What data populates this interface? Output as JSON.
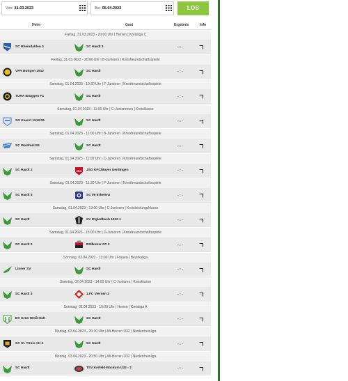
{
  "filter": {
    "from_label": "Von:",
    "from_value": "31.03.2023",
    "to_label": "Bis:",
    "to_value": "05.04.2023",
    "submit_label": "LOS"
  },
  "columns": {
    "home": "Heim",
    "away": "Gast",
    "result": "Ergebnis",
    "info": "Info"
  },
  "colors": {
    "accent": "#8dc63f",
    "sidebar": "#2f6e2f"
  },
  "matches": [
    {
      "header": "Freitag, 31.03.2023 - 20:00 Uhr | Herren | Kreisliga C",
      "home": "SC Rheindahlen 3",
      "home_crest": "crest-blue-shield",
      "away": "SC Hardt 3",
      "away_crest": "crest-green-hardt",
      "score": "- : -"
    },
    {
      "header": "Freitag, 31.03.2023 - 20:00 Uhr | B-Junioren | Kreisfreundschaftsspiele",
      "home": "VFR Büttgen 1912",
      "home_crest": "crest-yellow-round",
      "away": "SC Hardt",
      "away_crest": "crest-green-hardt",
      "score": "- : -"
    },
    {
      "header": "Samstag, 01.04.2023 - 10:30 Uhr | F-Junioren | Kreisfreundschaftsspiele",
      "home": "TURA Brüggen F1",
      "home_crest": "crest-black-yellow",
      "away": "SC Hardt",
      "away_crest": "crest-green-hardt",
      "score": "- : -"
    },
    {
      "header": "Samstag, 01.04.2023 - 11:00 Uhr | C-Juniorinnen | Kreisklasse",
      "home": "SG Kaarst 1912/35",
      "home_crest": "crest-blue-light",
      "away": "SC Hardt",
      "away_crest": "crest-green-hardt",
      "score": "- : -"
    },
    {
      "header": "Samstag, 01.04.2023 - 11:00 Uhr | B-Junioren | Kreisfreundschaftsspiele",
      "home": "SC Waldniel B1",
      "home_crest": "crest-blue-wing",
      "away": "SC Hardt",
      "away_crest": "crest-green-hardt",
      "score": "- : -"
    },
    {
      "header": "Samstag, 01.04.2023 - 11:00 Uhr | C-Junioren | Kreisfreundschaftsspiele",
      "home": "SC Hardt 2",
      "home_crest": "crest-green-hardt",
      "away": "JSG KFC/Bayer Uerdingen",
      "away_crest": "crest-red-shield",
      "score": "- : -"
    },
    {
      "header": "Samstag, 01.04.2023 - 11:30 Uhr | F-Junioren | Kreisfreundschaftsspiele",
      "home": "SC Hardt 3",
      "home_crest": "crest-green-hardt",
      "away": "SC 09 Erkelenz",
      "away_crest": "crest-navy-square",
      "score": "- : -"
    },
    {
      "header": "Samstag, 01.04.2023 - 13:00 Uhr | C-Junioren | Kreisleistungsklasse",
      "home": "SC Hardt",
      "home_crest": "crest-green-hardt",
      "away": "SV M'gladbach 1910 1",
      "away_crest": "crest-black-white",
      "score": "- : -"
    },
    {
      "header": "Samstag, 01.04.2023 - 15:00 Uhr | D-Junioren | Kreisfreundschaftsspiele",
      "home": "SC Hardt 2",
      "home_crest": "crest-green-hardt",
      "away": "Büllkener FC 2",
      "away_crest": "crest-red-black",
      "score": "- : -"
    },
    {
      "header": "Sonntag, 02.04.2023 - 13:00 Uhr | Frauen | Bezirksliga",
      "home": "Linner SV",
      "home_crest": "crest-green-wing",
      "away": "SC Hardt",
      "away_crest": "crest-green-hardt",
      "score": "- : -"
    },
    {
      "header": "Sonntag, 02.04.2023 - 14:00 Uhr | C-Junioren | Kreisklasse",
      "home": "SC Hardt 3",
      "home_crest": "crest-green-hardt",
      "away": "1.FC Viersen 2",
      "away_crest": "crest-red-diamond",
      "score": "- : -"
    },
    {
      "header": "Sonntag, 02.04.2023 - 15:00 Uhr | Herren | Kreisliga A",
      "home": "BV Grün Weiß Holt",
      "home_crest": "crest-green-white",
      "away": "SC Hardt",
      "away_crest": "crest-green-hardt",
      "score": "- : -"
    },
    {
      "header": "Montag, 03.04.2023 - 20:10 Uhr | Alt-Herren Ü32 | Niederrheinliga",
      "home": "SC St. Tönis AH 2",
      "home_crest": "crest-black-gold",
      "away": "SC Hardt",
      "away_crest": "crest-green-hardt",
      "score": "- : -"
    },
    {
      "header": "Montag, 03.04.2023 - 20:50 Uhr | Alt-Herren Ü32 | Niederrheinliga",
      "home": "SC Hardt",
      "home_crest": "crest-green-hardt",
      "away": "TSV Krefeld-Bockum Ü32 - 2",
      "away_crest": "crest-dark-oval",
      "score": "- : -"
    }
  ]
}
